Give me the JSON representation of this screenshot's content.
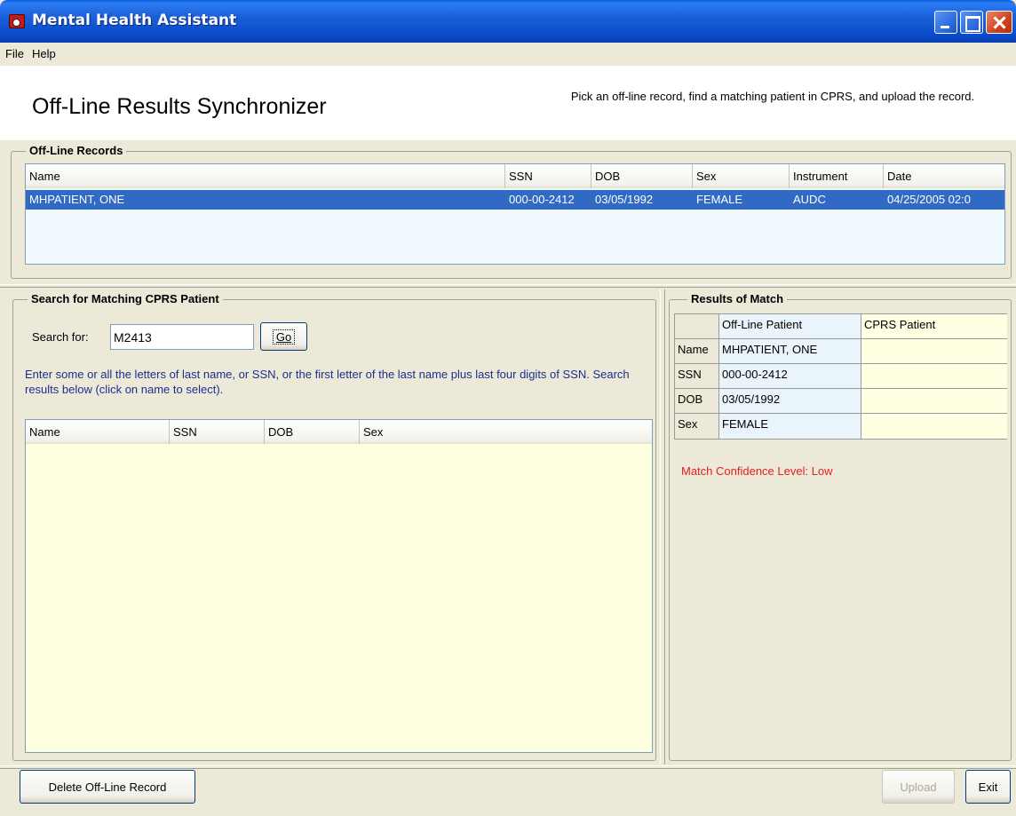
{
  "window": {
    "title": "Mental Health Assistant",
    "controls": {
      "minimize": "minimize",
      "maximize": "maximize",
      "close": "close"
    }
  },
  "menu": {
    "file": "File",
    "help": "Help"
  },
  "header": {
    "title": "Off-Line Results Synchronizer",
    "instructions": "Pick an off-line record, find a matching patient in CPRS, and upload the record."
  },
  "offline_records": {
    "legend": "Off-Line Records",
    "columns": [
      "Name",
      "SSN",
      "DOB",
      "Sex",
      "Instrument",
      "Date"
    ],
    "rows": [
      {
        "name": "MHPATIENT, ONE",
        "ssn": "000-00-2412",
        "dob": "03/05/1992",
        "sex": "FEMALE",
        "instrument": "AUDC",
        "date": "04/25/2005 02:0"
      }
    ]
  },
  "search": {
    "legend": "Search for Matching CPRS Patient",
    "label": "Search for:",
    "value": "M2413",
    "go_button": "Go",
    "hint": "Enter some or all the letters of last name, or SSN, or the first letter of the last name plus last four digits of SSN. Search results below (click on name to select).",
    "columns": [
      "Name",
      "SSN",
      "DOB",
      "Sex"
    ]
  },
  "match": {
    "legend": "Results of Match",
    "col_offline": "Off-Line Patient",
    "col_cprs": "CPRS Patient",
    "rows": [
      {
        "label": "Name",
        "offline": "MHPATIENT, ONE",
        "cprs": ""
      },
      {
        "label": "SSN",
        "offline": "000-00-2412",
        "cprs": ""
      },
      {
        "label": "DOB",
        "offline": "03/05/1992",
        "cprs": ""
      },
      {
        "label": "Sex",
        "offline": "FEMALE",
        "cprs": ""
      }
    ],
    "confidence": "Match Confidence Level:  Low",
    "confidence_color": "#e12020"
  },
  "footer": {
    "delete_button": "Delete Off-Line Record",
    "upload_button": "Upload",
    "exit_button": "Exit"
  }
}
